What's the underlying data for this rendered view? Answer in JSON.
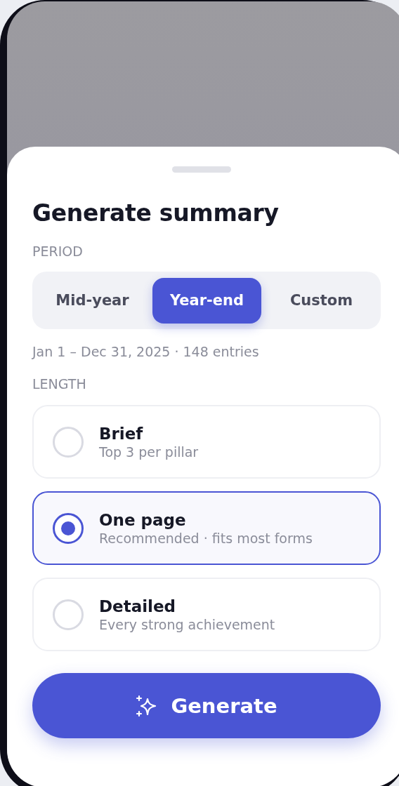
{
  "sheet": {
    "title": "Generate summary"
  },
  "period": {
    "label": "PERIOD",
    "options": [
      {
        "label": "Mid-year",
        "selected": false
      },
      {
        "label": "Year-end",
        "selected": true
      },
      {
        "label": "Custom",
        "selected": false
      }
    ],
    "summary": "Jan 1 – Dec 31, 2025 · 148 entries"
  },
  "length": {
    "label": "LENGTH",
    "options": [
      {
        "title": "Brief",
        "subtitle": "Top 3 per pillar",
        "selected": false
      },
      {
        "title": "One page",
        "subtitle": "Recommended · fits most forms",
        "selected": true
      },
      {
        "title": "Detailed",
        "subtitle": "Every strong achievement",
        "selected": false
      }
    ]
  },
  "button": {
    "label": "Generate"
  }
}
